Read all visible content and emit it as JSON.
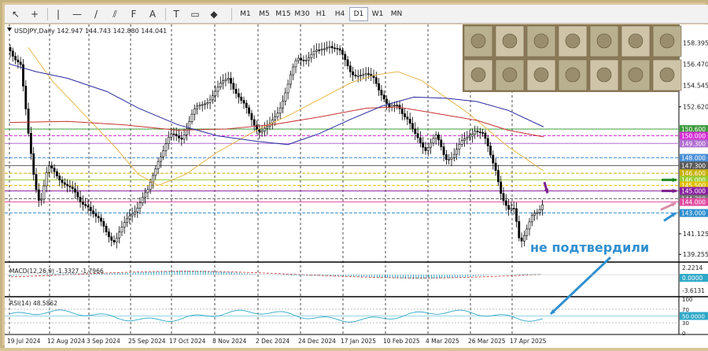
{
  "toolbar": {
    "timeframes": [
      {
        "label": "M1",
        "active": false
      },
      {
        "label": "M5",
        "active": false
      },
      {
        "label": "M15",
        "active": false
      },
      {
        "label": "M30",
        "active": false
      },
      {
        "label": "H1",
        "active": false
      },
      {
        "label": "H4",
        "active": false
      },
      {
        "label": "D1",
        "active": true
      },
      {
        "label": "W1",
        "active": false
      },
      {
        "label": "MN",
        "active": false
      }
    ],
    "icons": [
      "cursor-icon",
      "crosshair-icon",
      "vertical-line-icon",
      "horizontal-line-icon",
      "trendline-icon",
      "equidistant-channel-icon",
      "fibonacci-icon",
      "text-icon",
      "text-label-icon",
      "rectangle-icon",
      "shapes-menu-icon"
    ]
  },
  "chart": {
    "header": "USDJPY,Daily  142.947 144.743 142.880 144.041",
    "annotation": "не подтвердили",
    "price_labels": [
      "158.395",
      "156.470",
      "154.545",
      "152.620",
      "141.125",
      "139.255"
    ],
    "level_labels": [
      {
        "text": "150.600",
        "color": "#3c9b3c",
        "price": 150.6
      },
      {
        "text": "150.000",
        "color": "#d62fd6",
        "price": 150.0
      },
      {
        "text": "149.300",
        "color": "#b06fd0",
        "price": 149.3
      },
      {
        "text": "148.000",
        "color": "#4a8fd8",
        "price": 148.0
      },
      {
        "text": "147.300",
        "color": "#5a5a5a",
        "price": 147.3
      },
      {
        "text": "146.600",
        "color": "#c8b000",
        "price": 146.6
      },
      {
        "text": "146.000",
        "color": "#9acd32",
        "price": 146.0
      },
      {
        "text": "145.500",
        "color": "#e0c000",
        "price": 145.5
      },
      {
        "text": "145.000",
        "color": "#8a1fa0",
        "price": 145.0
      },
      {
        "text": "144.300",
        "color": "#707070",
        "price": 144.3
      },
      {
        "text": "144.000",
        "color": "#e04aa0",
        "price": 144.0
      },
      {
        "text": "143.000",
        "color": "#2f8fd0",
        "price": 143.0
      }
    ],
    "date_labels": [
      "19 Jul 2024",
      "12 Aug 2024",
      "3 Sep 2024",
      "25 Sep 2024",
      "17 Oct 2024",
      "8 Nov 2024",
      "2 Dec 2024",
      "24 Dec 2024",
      "17 Jan 2025",
      "10 Feb 2025",
      "4 Mar 2025",
      "26 Mar 2025",
      "17 Apr 2025"
    ],
    "macd": {
      "label": "MACD(12,26,9) -1.3327 -1.7966",
      "scale": [
        "2.2214",
        "0.0000",
        "-3.6131"
      ]
    },
    "rsi": {
      "label": "RSI(14) 48.5862",
      "scale": [
        "100",
        "70",
        "50.0000",
        "30",
        "0"
      ]
    }
  },
  "colors": {
    "bull": "#000000",
    "bear": "#000000",
    "ma_fast": "#e8b64a",
    "ma_mid": "#c83232",
    "ma_slow": "#2a2aa0",
    "annotation": "#2f8fd0"
  }
}
